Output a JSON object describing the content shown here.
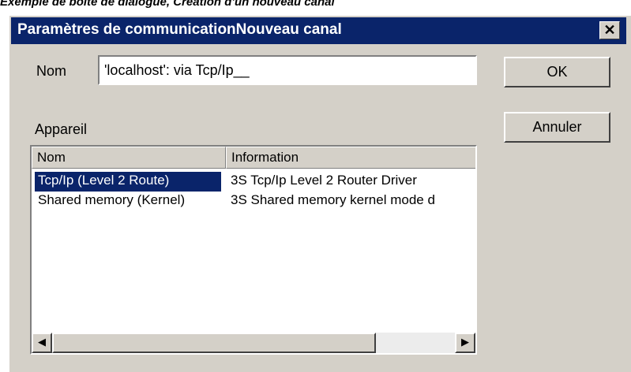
{
  "caption": "Exemple de boîte de dialogue, Création d'un nouveau canal",
  "dialog": {
    "title": "Paramètres de communicationNouveau canal",
    "close_label": "✕"
  },
  "name_field": {
    "label": "Nom",
    "value": "'localhost': via Tcp/Ip__"
  },
  "buttons": {
    "ok": "OK",
    "cancel": "Annuler"
  },
  "device_list": {
    "label": "Appareil",
    "columns": [
      "Nom",
      "Information"
    ],
    "rows": [
      {
        "name": "Tcp/Ip (Level 2 Route)",
        "info": "3S Tcp/Ip Level 2 Router Driver",
        "selected": true
      },
      {
        "name": "Shared memory (Kernel)",
        "info": "3S Shared memory kernel mode d",
        "selected": false
      }
    ]
  },
  "scrollbar": {
    "left_arrow": "◀",
    "right_arrow": "▶"
  }
}
